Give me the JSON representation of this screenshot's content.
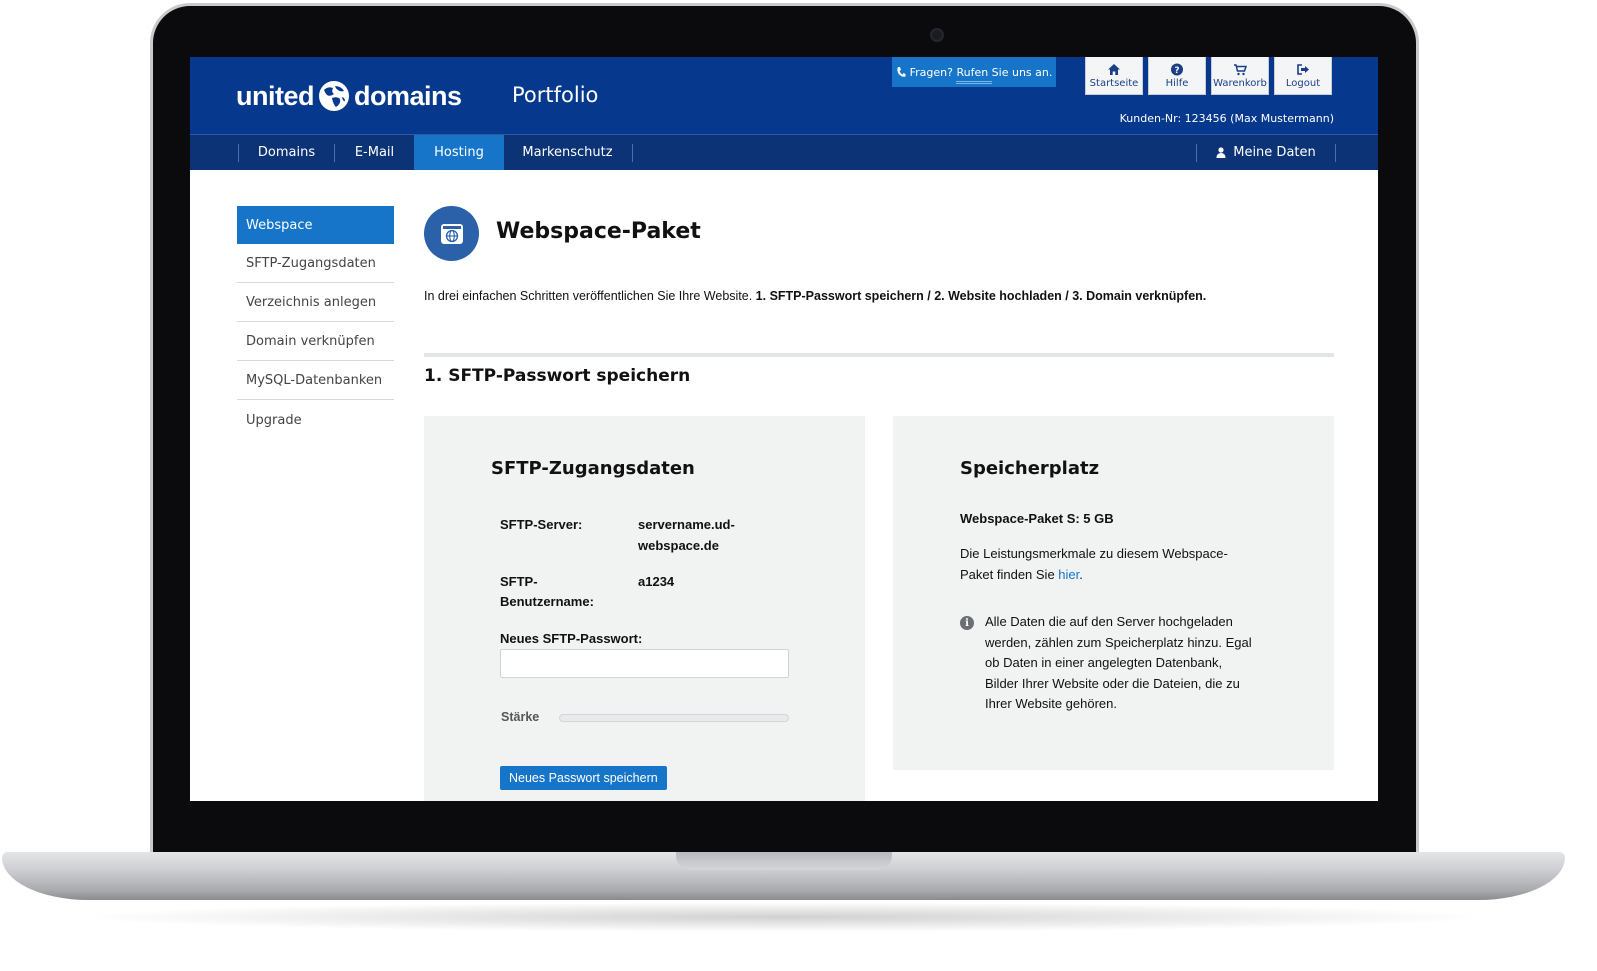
{
  "brand": {
    "logo_left": "united",
    "logo_right": "domains",
    "product": "Portfolio",
    "primary_color": "#06398d",
    "accent_color": "#1675c8"
  },
  "header": {
    "call_label": "Fragen? Rufen Sie uns an.",
    "buttons": [
      {
        "label": "Startseite",
        "icon": "home-icon"
      },
      {
        "label": "Hilfe",
        "icon": "help-icon"
      },
      {
        "label": "Warenkorb",
        "icon": "cart-icon"
      },
      {
        "label": "Logout",
        "icon": "logout-icon"
      }
    ],
    "customer_info": "Kunden-Nr: 123456 (Max Mustermann)"
  },
  "nav": {
    "items": [
      {
        "label": "Domains"
      },
      {
        "label": "E-Mail"
      },
      {
        "label": "Hosting",
        "active": true
      },
      {
        "label": "Markenschutz"
      }
    ],
    "account_label": "Meine Daten"
  },
  "sidebar": {
    "items": [
      {
        "label": "Webspace",
        "active": true
      },
      {
        "label": "SFTP-Zugangsdaten"
      },
      {
        "label": "Verzeichnis anlegen"
      },
      {
        "label": "Domain verknüpfen"
      },
      {
        "label": "MySQL-Datenbanken"
      },
      {
        "label": "Upgrade"
      }
    ]
  },
  "main": {
    "title": "Webspace-Paket",
    "intro_text": "In drei einfachen Schritten veröffentlichen Sie Ihre Website. ",
    "intro_steps": "1. SFTP-Passwort speichern / 2. Website hochladen / 3. Domain verknüpfen.",
    "section_title": "1. SFTP-Passwort speichern"
  },
  "sftp_panel": {
    "title": "SFTP-Zugangsdaten",
    "server_label": "SFTP-Server:",
    "server_value_line1": "servername.ud-",
    "server_value_line2": "webspace.de",
    "user_label_line1": "SFTP-",
    "user_label_line2": "Benutzername:",
    "user_value": "a1234",
    "password_label": "Neues SFTP-Passwort:",
    "password_value": "",
    "strength_label": "Stärke",
    "strength_value": 0,
    "save_label": "Neues Passwort speichern"
  },
  "storage_panel": {
    "title": "Speicherplatz",
    "package": "Webspace-Paket S: 5 GB",
    "features_line1": "Die Leistungsmerkmale zu diesem Webspace-",
    "features_line2_prefix": "Paket finden Sie ",
    "features_link": "hier",
    "features_line2_suffix": ".",
    "info_lines": [
      "Alle Daten die auf den Server hochgeladen",
      "werden, zählen zum Speicherplatz hinzu. Egal",
      "ob Daten in einer angelegten Datenbank,",
      "Bilder Ihrer Website oder die Dateien, die zu",
      "Ihrer Website gehören."
    ]
  }
}
